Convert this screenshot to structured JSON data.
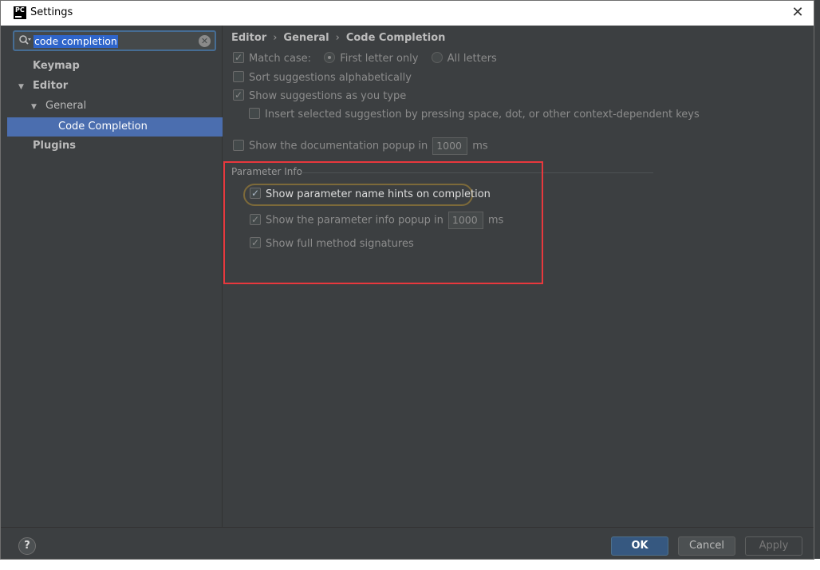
{
  "window": {
    "title": "Settings",
    "app_icon": "PC",
    "close_glyph": "✕"
  },
  "search": {
    "value": "code completion",
    "clear_glyph": "✕"
  },
  "tree": {
    "keymap": "Keymap",
    "editor": "Editor",
    "general": "General",
    "code_completion": "Code Completion",
    "plugins": "Plugins"
  },
  "breadcrumb": {
    "editor": "Editor",
    "general": "General",
    "code_completion": "Code Completion",
    "sep": "›"
  },
  "options": {
    "match_case": "Match case:",
    "first_letter": "First letter only",
    "all_letters": "All letters",
    "sort_alpha": "Sort suggestions alphabetically",
    "show_as_type": "Show suggestions as you type",
    "insert_selected": "Insert selected suggestion by pressing space, dot, or other context-dependent keys",
    "doc_popup": "Show the documentation popup in",
    "doc_popup_ms": "1000",
    "ms": "ms"
  },
  "parameter_info": {
    "label": "Parameter Info",
    "hints": "Show parameter name hints on completion",
    "info_popup": "Show the parameter info popup in",
    "info_popup_ms": "1000",
    "ms": "ms",
    "full_sig": "Show full method signatures"
  },
  "footer": {
    "help": "?",
    "ok": "OK",
    "cancel": "Cancel",
    "apply": "Apply"
  },
  "colors": {
    "selection": "#4b6eaf",
    "highlight_frame": "#e8383d",
    "ok_button": "#365880"
  }
}
